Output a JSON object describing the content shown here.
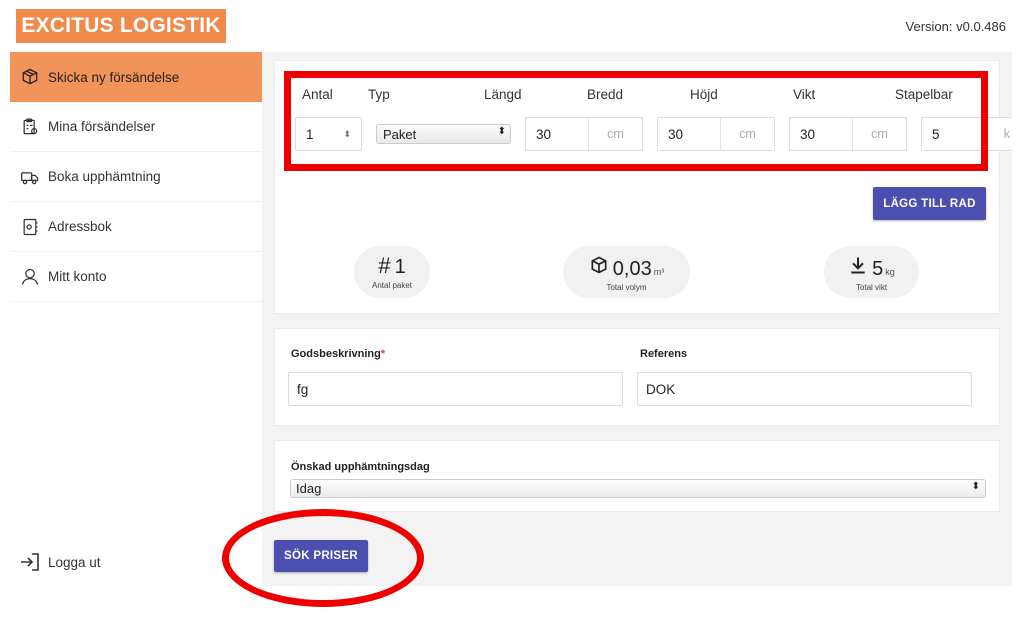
{
  "header": {
    "logo": "EXCITUS LOGISTIK",
    "version": "Version: v0.0.486"
  },
  "sidebar": {
    "items": [
      {
        "label": "Skicka ny försändelse",
        "icon": "box-send-icon",
        "active": true
      },
      {
        "label": "Mina försändelser",
        "icon": "clipboard-icon",
        "active": false
      },
      {
        "label": "Boka upphämtning",
        "icon": "truck-icon",
        "active": false
      },
      {
        "label": "Adressbok",
        "icon": "address-book-icon",
        "active": false
      },
      {
        "label": "Mitt konto",
        "icon": "user-icon",
        "active": false
      }
    ],
    "logout": "Logga ut"
  },
  "package": {
    "headers": {
      "antal": "Antal",
      "typ": "Typ",
      "langd": "Längd",
      "bredd": "Bredd",
      "hojd": "Höjd",
      "vikt": "Vikt",
      "stapelbar": "Stapelbar"
    },
    "antal": "1",
    "typ": "Paket",
    "langd": "30",
    "bredd": "30",
    "hojd": "30",
    "vikt": "5",
    "unit_cm": "cm",
    "unit_kg": "k",
    "add_row": "LÄGG TILL RAD"
  },
  "summary": {
    "count": {
      "icon": "#",
      "value": "1",
      "label": "Antal paket"
    },
    "volume": {
      "value": "0,03",
      "unit": "m³",
      "label": "Total volym"
    },
    "weight": {
      "value": "5",
      "unit": "kg",
      "label": "Total vikt"
    }
  },
  "details": {
    "goods_label": "Godsbeskrivning",
    "goods_required": "*",
    "goods_value": "fg",
    "ref_label": "Referens",
    "ref_value": "DOK"
  },
  "pickup": {
    "label": "Önskad upphämtningsdag",
    "value": "Idag"
  },
  "search_button": "SÖK PRISER",
  "colors": {
    "brand": "#f08a4b",
    "active": "#f2935a",
    "primary": "#4a4fb0",
    "annotation": "#ee0000"
  }
}
